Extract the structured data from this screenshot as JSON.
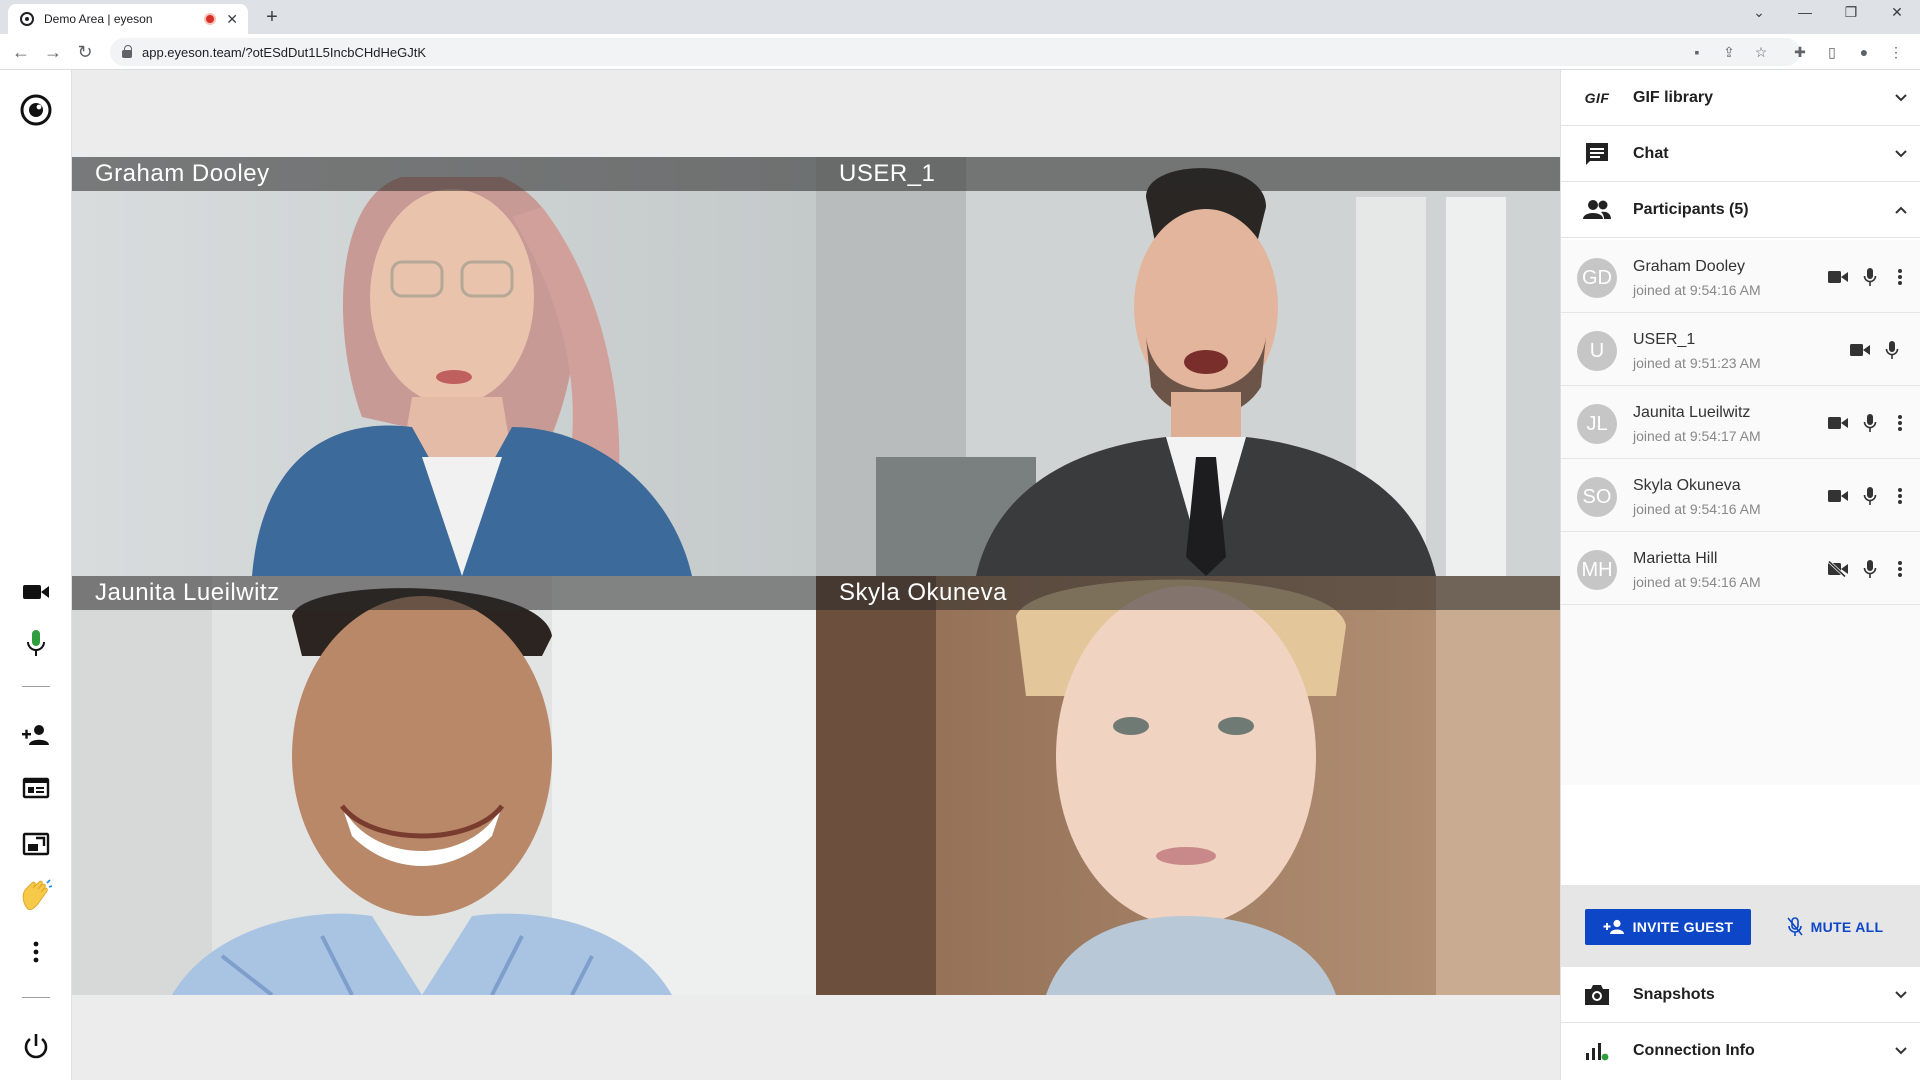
{
  "browser": {
    "tab_title": "Demo Area | eyeson",
    "new_tab": "+",
    "url": "app.eyeson.team/?otESdDut1L5IncbCHdHeGJtK"
  },
  "videos": [
    {
      "name": "Graham Dooley"
    },
    {
      "name": "USER_1"
    },
    {
      "name": "Jaunita Lueilwitz"
    },
    {
      "name": "Skyla Okuneva"
    }
  ],
  "panel": {
    "gif_badge": "GIF",
    "gif_title": "GIF library",
    "chat_title": "Chat",
    "participants_title": "Participants (5)",
    "participants": [
      {
        "initials": "GD",
        "name": "Graham Dooley",
        "joined": "joined at 9:54:16 AM",
        "camera": "on",
        "menu": true
      },
      {
        "initials": "U",
        "name": "USER_1",
        "joined": "joined at 9:51:23 AM",
        "camera": "on",
        "menu": false
      },
      {
        "initials": "JL",
        "name": "Jaunita Lueilwitz",
        "joined": "joined at 9:54:17 AM",
        "camera": "on",
        "menu": true
      },
      {
        "initials": "SO",
        "name": "Skyla Okuneva",
        "joined": "joined at 9:54:16 AM",
        "camera": "on",
        "menu": true
      },
      {
        "initials": "MH",
        "name": "Marietta Hill",
        "joined": "joined at 9:54:16 AM",
        "camera": "off",
        "menu": true
      }
    ],
    "invite_label": "INVITE GUEST",
    "mute_label": "MUTE ALL",
    "snapshots_title": "Snapshots",
    "connection_title": "Connection Info"
  },
  "colors": {
    "accent": "#0d47c7",
    "mic_active": "#2e9e3e",
    "recording": "#d93025"
  }
}
